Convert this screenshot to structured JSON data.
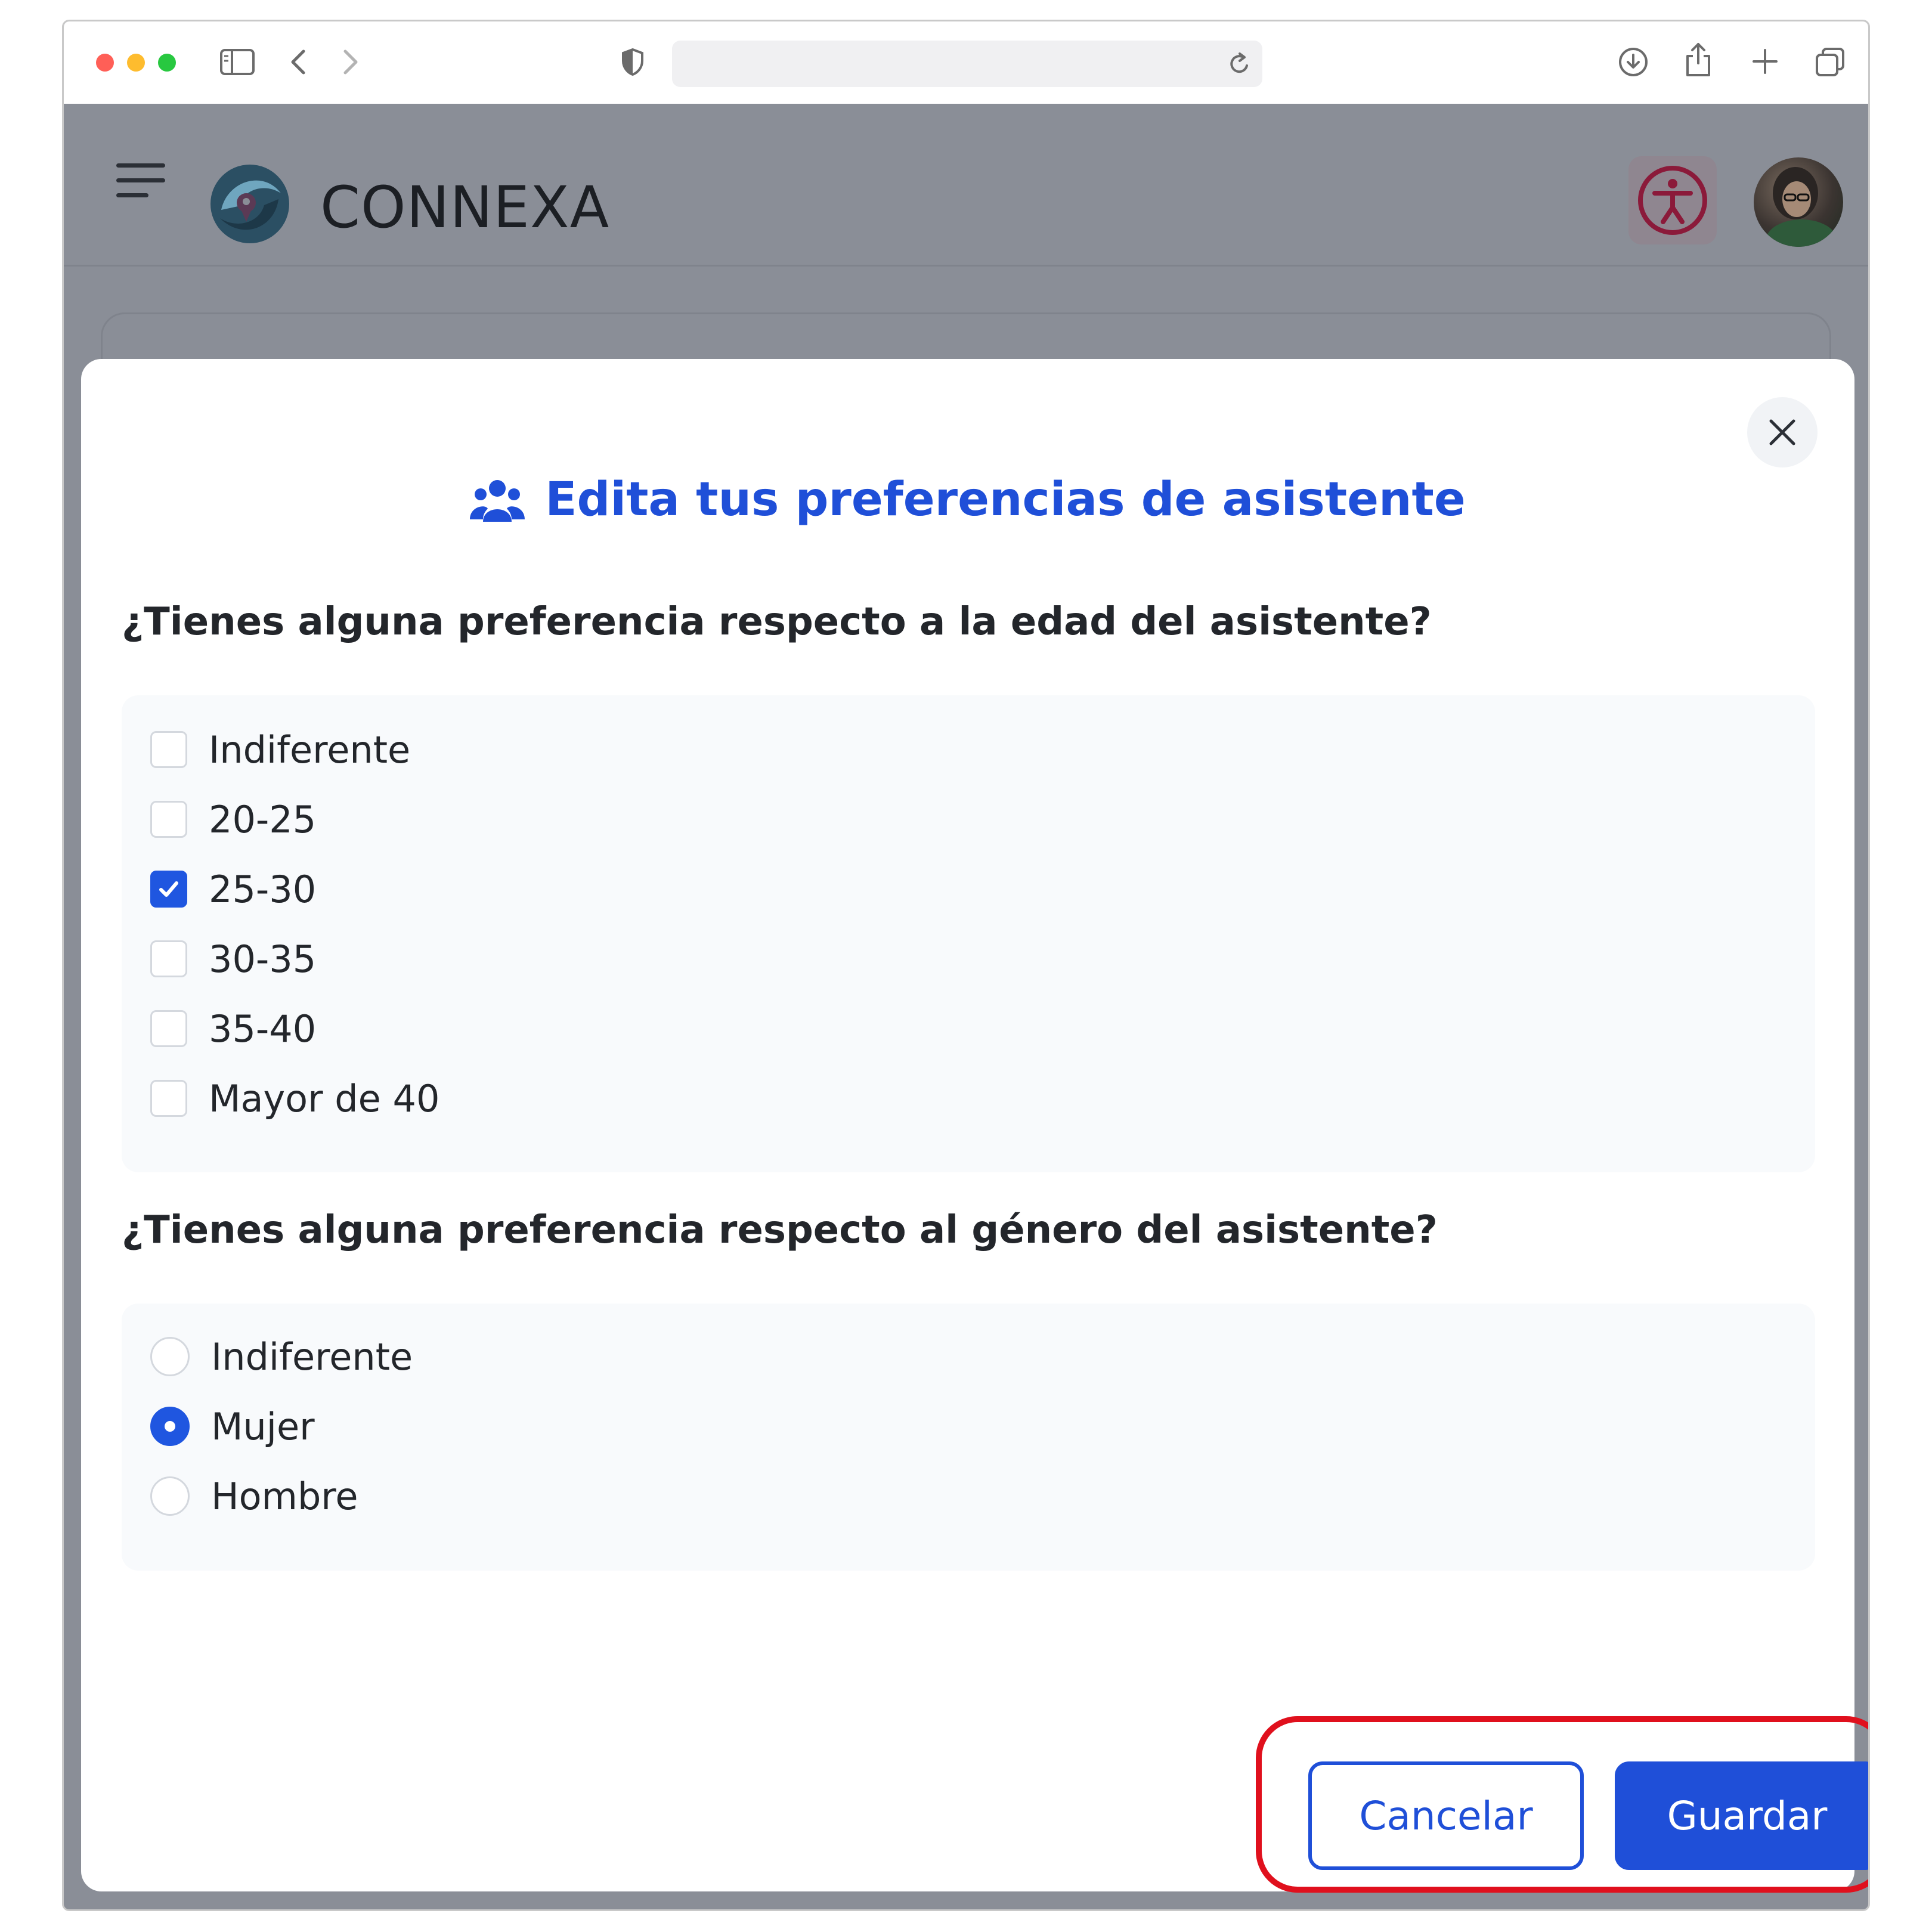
{
  "browser": {
    "url": ""
  },
  "header": {
    "brand": "CONNEXA"
  },
  "modal": {
    "title": "Edita tus preferencias de asistente",
    "age_question": "¿Tienes alguna preferencia respecto a la edad del asistente?",
    "age_options": [
      {
        "label": "Indiferente",
        "checked": false
      },
      {
        "label": "20-25",
        "checked": false
      },
      {
        "label": "25-30",
        "checked": true
      },
      {
        "label": "30-35",
        "checked": false
      },
      {
        "label": "35-40",
        "checked": false
      },
      {
        "label": "Mayor de 40",
        "checked": false
      }
    ],
    "gender_question": "¿Tienes alguna preferencia respecto al género del asistente?",
    "gender_options": [
      {
        "label": "Indiferente",
        "selected": false
      },
      {
        "label": "Mujer",
        "selected": true
      },
      {
        "label": "Hombre",
        "selected": false
      }
    ],
    "cancel_label": "Cancelar",
    "save_label": "Guardar"
  },
  "colors": {
    "accent": "#1f4fd8",
    "highlight": "#e0101d",
    "overlay": "#8a8e97",
    "accessibility": "#8b1a3a"
  },
  "icons": {
    "title": "users-group-icon",
    "close": "close-icon",
    "accessibility": "accessibility-icon"
  }
}
